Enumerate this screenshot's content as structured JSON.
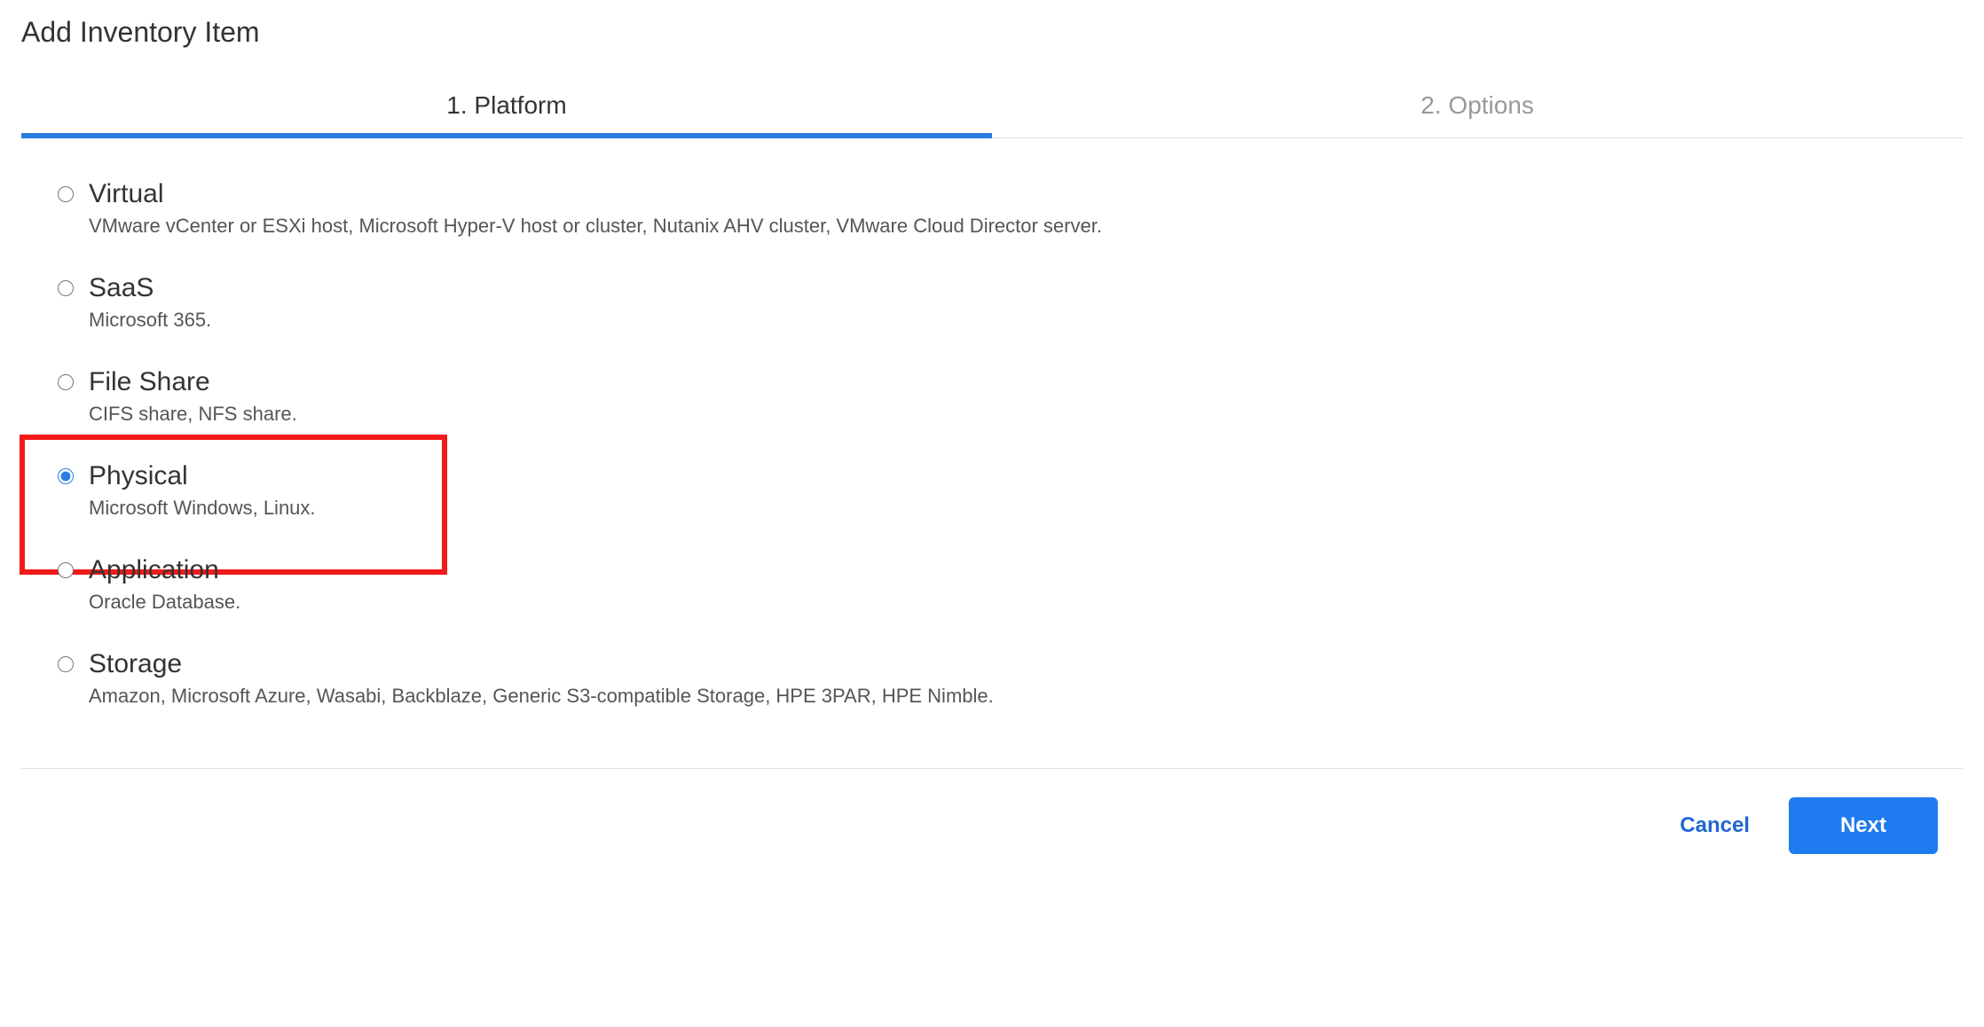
{
  "dialog": {
    "title": "Add Inventory Item"
  },
  "tabs": [
    {
      "label": "1. Platform",
      "active": true
    },
    {
      "label": "2. Options",
      "active": false
    }
  ],
  "options": [
    {
      "id": "virtual",
      "title": "Virtual",
      "desc": "VMware vCenter or ESXi host, Microsoft Hyper-V host or cluster, Nutanix AHV cluster, VMware Cloud Director server.",
      "selected": false,
      "highlight": false
    },
    {
      "id": "saas",
      "title": "SaaS",
      "desc": "Microsoft 365.",
      "selected": false,
      "highlight": false
    },
    {
      "id": "fileshare",
      "title": "File Share",
      "desc": "CIFS share, NFS share.",
      "selected": false,
      "highlight": false
    },
    {
      "id": "physical",
      "title": "Physical",
      "desc": "Microsoft Windows, Linux.",
      "selected": true,
      "highlight": true
    },
    {
      "id": "application",
      "title": "Application",
      "desc": "Oracle Database.",
      "selected": false,
      "highlight": false
    },
    {
      "id": "storage",
      "title": "Storage",
      "desc": "Amazon, Microsoft Azure, Wasabi, Backblaze, Generic S3-compatible Storage, HPE 3PAR, HPE Nimble.",
      "selected": false,
      "highlight": false
    }
  ],
  "footer": {
    "cancel": "Cancel",
    "next": "Next"
  }
}
